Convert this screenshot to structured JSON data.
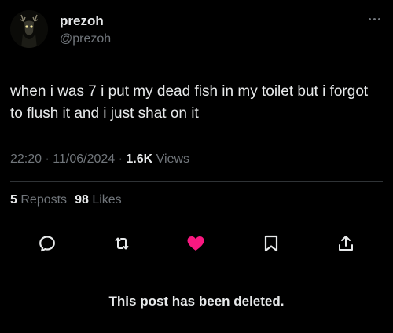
{
  "author": {
    "display_name": "prezoh",
    "handle": "@prezoh"
  },
  "tweet": {
    "text": "when i was 7 i put my dead fish in my toilet but i forgot to flush it and i just shat on it",
    "time": "22:20",
    "date": "11/06/2024",
    "views_count": "1.6K",
    "views_label": "Views"
  },
  "stats": {
    "reposts_count": "5",
    "reposts_label": "Reposts",
    "likes_count": "98",
    "likes_label": "Likes"
  },
  "actions": [
    "reply-icon",
    "repost-icon",
    "like-icon",
    "bookmark-icon",
    "share-icon"
  ],
  "colors": {
    "background": "#000000",
    "text": "#e7e9ea",
    "muted": "#71767b",
    "like": "#f91880",
    "divider": "#2f3336"
  },
  "notice": {
    "deleted": "This post has been deleted."
  }
}
